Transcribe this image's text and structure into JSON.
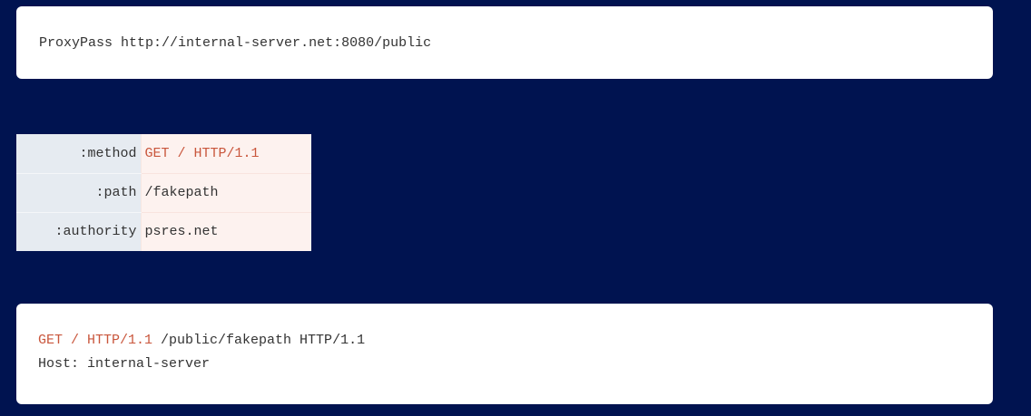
{
  "proxy_config": {
    "directive": "ProxyPass",
    "url": "http://internal-server.net:8080/public"
  },
  "h2_headers": [
    {
      "key": ":method",
      "value": "GET / HTTP/1.1",
      "highlight": true
    },
    {
      "key": ":path",
      "value": "/fakepath",
      "highlight": false
    },
    {
      "key": ":authority",
      "value": "psres.net",
      "highlight": false
    }
  ],
  "forwarded_request": {
    "injected": "GET / HTTP/1.1",
    "rest_of_line1": " /public/fakepath HTTP/1.1",
    "line2": "Host: internal-server"
  },
  "colors": {
    "background": "#001350",
    "highlight": "#c9563c",
    "text": "#333333"
  }
}
